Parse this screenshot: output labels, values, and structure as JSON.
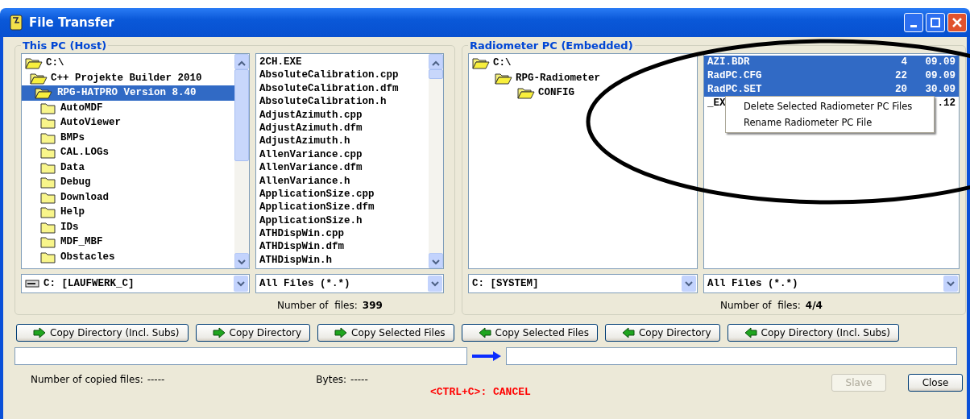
{
  "window": {
    "title": "File Transfer"
  },
  "host": {
    "title": "This PC (Host)",
    "tree": [
      {
        "label": "C:\\",
        "expanded": true,
        "selected": false,
        "children": [
          {
            "label": "C++ Projekte Builder 2010",
            "expanded": true,
            "selected": false,
            "children": [
              {
                "label": "RPG-HATPRO Version 8.40",
                "expanded": true,
                "selected": true,
                "children": [
                  {
                    "label": "AutoMDF",
                    "expanded": false,
                    "selected": false
                  },
                  {
                    "label": "AutoViewer",
                    "expanded": false,
                    "selected": false
                  },
                  {
                    "label": "BMPs",
                    "expanded": false,
                    "selected": false
                  },
                  {
                    "label": "CAL.LOGs",
                    "expanded": false,
                    "selected": false
                  },
                  {
                    "label": "Data",
                    "expanded": false,
                    "selected": false
                  },
                  {
                    "label": "Debug",
                    "expanded": false,
                    "selected": false
                  },
                  {
                    "label": "Download",
                    "expanded": false,
                    "selected": false
                  },
                  {
                    "label": "Help",
                    "expanded": false,
                    "selected": false
                  },
                  {
                    "label": "IDs",
                    "expanded": false,
                    "selected": false
                  },
                  {
                    "label": "MDF_MBF",
                    "expanded": false,
                    "selected": false
                  },
                  {
                    "label": "Obstacles",
                    "expanded": false,
                    "selected": false
                  }
                ]
              }
            ]
          }
        ]
      }
    ],
    "files": [
      "2CH.EXE",
      "AbsoluteCalibration.cpp",
      "AbsoluteCalibration.dfm",
      "AbsoluteCalibration.h",
      "AdjustAzimuth.cpp",
      "AdjustAzimuth.dfm",
      "AdjustAzimuth.h",
      "AllenVariance.cpp",
      "AllenVariance.dfm",
      "AllenVariance.h",
      "ApplicationSize.cpp",
      "ApplicationSize.dfm",
      "ApplicationSize.h",
      "ATHDispWin.cpp",
      "ATHDispWin.dfm",
      "ATHDispWin.h"
    ],
    "drive": "C: [LAUFWERK_C]",
    "filter": "All Files (*.*)",
    "count_label": "Number of  files:",
    "count": "399"
  },
  "radiometer": {
    "title": "Radiometer PC (Embedded)",
    "tree": [
      {
        "label": "C:\\",
        "expanded": true,
        "selected": false,
        "children": [
          {
            "label": "RPG-Radiometer",
            "expanded": true,
            "selected": false,
            "children": [
              {
                "label": "CONFIG",
                "expanded": true,
                "selected": false
              }
            ]
          }
        ]
      }
    ],
    "files": [
      {
        "name": "AZI.BDR",
        "size": "4",
        "date": "09.09",
        "selected": true
      },
      {
        "name": "RadPC.CFG",
        "size": "22",
        "date": "09.09",
        "selected": true
      },
      {
        "name": "RadPC.SET",
        "size": "20",
        "date": "30.09",
        "selected": true
      },
      {
        "name": "_EX",
        "date": ".12",
        "selected": false
      }
    ],
    "drive": "C: [SYSTEM]",
    "filter": "All Files (*.*)",
    "count_label": "Number of  files:",
    "count": "4/4"
  },
  "context_menu": [
    "Delete Selected Radiometer PC Files",
    "Rename Radiometer PC File"
  ],
  "copy_buttons": [
    {
      "label": "Copy Directory (Incl. Subs)",
      "kind": "right"
    },
    {
      "label": "Copy Directory",
      "kind": "right"
    },
    {
      "label": "Copy Selected Files",
      "kind": "right"
    },
    {
      "label": "Copy Selected Files",
      "kind": "left"
    },
    {
      "label": "Copy Directory",
      "kind": "left"
    },
    {
      "label": "Copy Directory (Incl. Subs)",
      "kind": "left"
    }
  ],
  "status": {
    "copied_label": "Number of copied files:",
    "copied": "-----",
    "bytes_label": "Bytes:",
    "bytes": "-----",
    "cancel": "<CTRL+C>: CANCEL"
  },
  "buttons": [
    {
      "label": "Slave",
      "disabled": true
    },
    {
      "label": "Close",
      "disabled": false
    }
  ]
}
